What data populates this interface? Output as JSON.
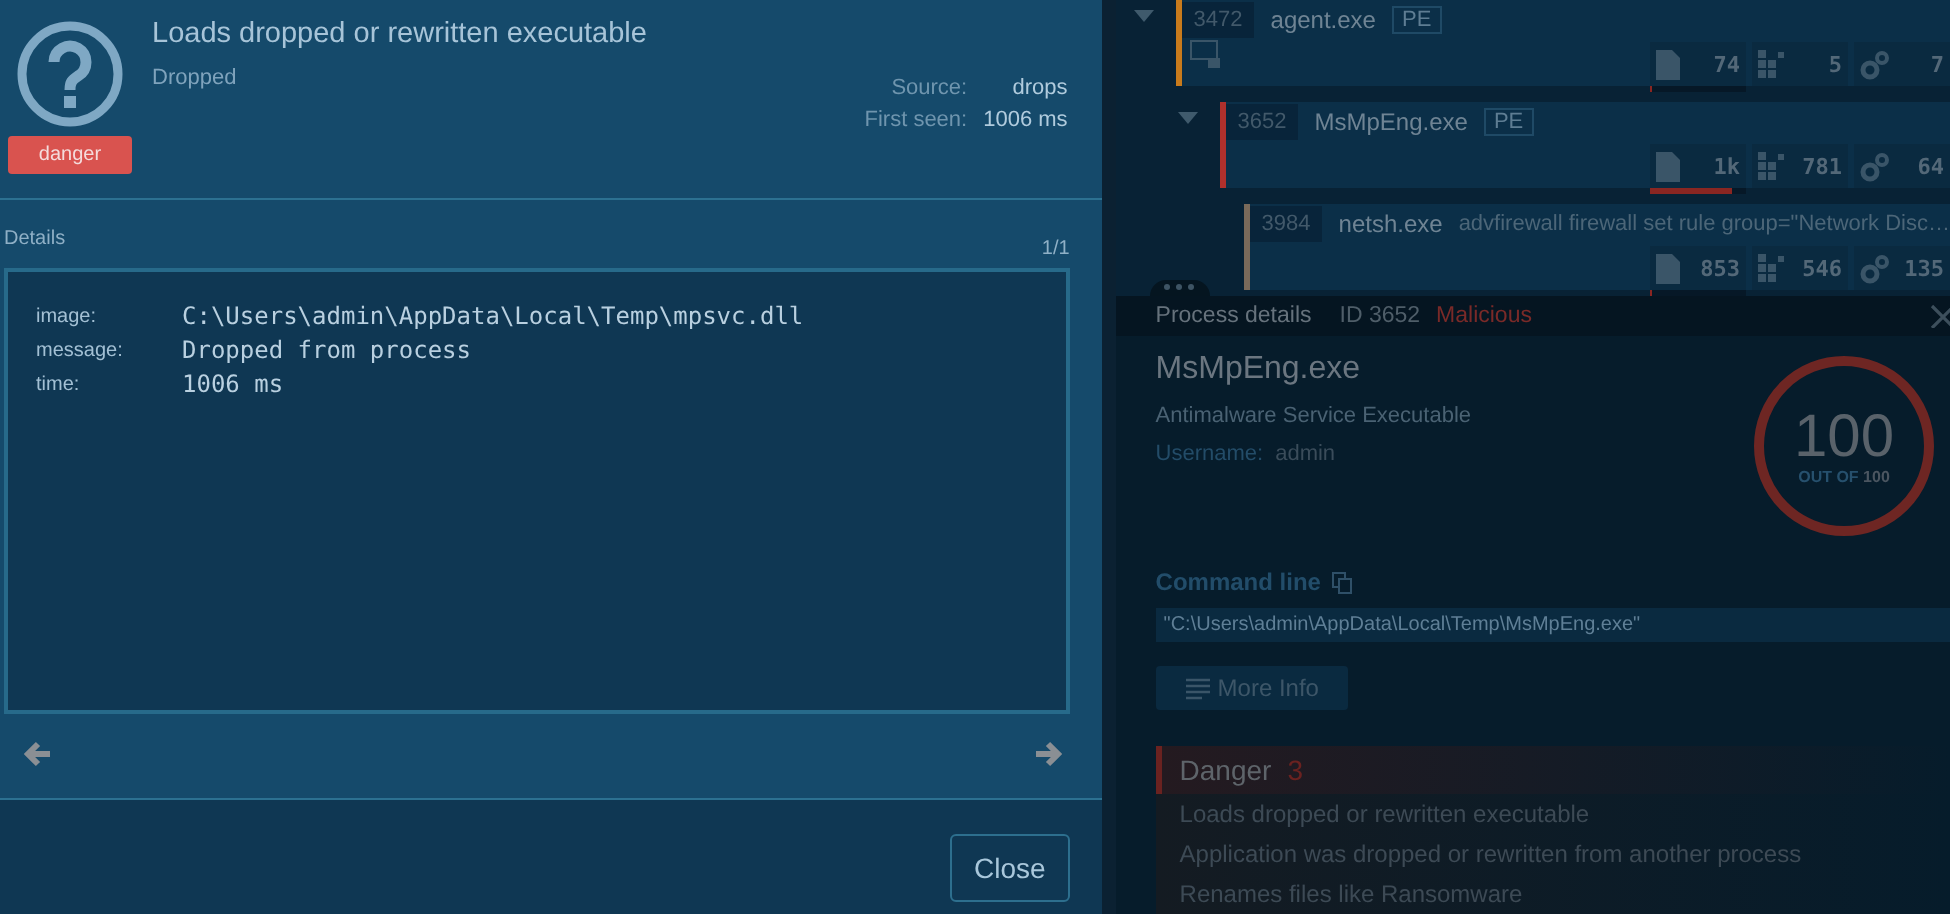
{
  "dialog": {
    "title": "Loads dropped or rewritten executable",
    "subtitle": "Dropped",
    "badge": "danger",
    "source_label": "Source:",
    "source": "drops",
    "first_seen_label": "First seen:",
    "first_seen": "1006 ms"
  },
  "details": {
    "heading": "Details",
    "pager": "1/1",
    "fields": [
      {
        "key": "image:",
        "value": "C:\\Users\\admin\\AppData\\Local\\Temp\\mpsvc.dll"
      },
      {
        "key": "message:",
        "value": "Dropped from process"
      },
      {
        "key": "time:",
        "value": "1006 ms"
      }
    ]
  },
  "close_button": "Close",
  "process_tree": [
    {
      "pid": "3472",
      "name": "agent.exe",
      "tag": "PE",
      "expanded": true,
      "color": "#c97b1c",
      "files": "74",
      "registry": "5",
      "modules": "7",
      "level": 0.02,
      "children": [
        {
          "pid": "3652",
          "name": "MsMpEng.exe",
          "tag": "PE",
          "expanded": true,
          "color": "#b0302c",
          "files": "1k",
          "registry": "781",
          "modules": "64",
          "level": 0.85,
          "children": [
            {
              "pid": "3984",
              "name": "netsh.exe",
              "args": "advfirewall firewall set rule group=\"Network Disc…",
              "color": "#7a6a5a",
              "files": "853",
              "registry": "546",
              "modules": "135",
              "level": 0.02
            }
          ]
        }
      ]
    }
  ],
  "process_details": {
    "title": "Process details",
    "id": "ID 3652",
    "verdict": "Malicious",
    "name": "MsMpEng.exe",
    "description": "Antimalware Service Executable",
    "username_label": "Username:",
    "username": "admin",
    "score": "100",
    "score_prefix": "OUT OF",
    "score_max": "100",
    "command_label": "Command line",
    "command": "\"C:\\Users\\admin\\AppData\\Local\\Temp\\MsMpEng.exe\"",
    "more_info": "More Info",
    "danger_label": "Danger",
    "danger_count": "3",
    "danger_items": [
      "Loads dropped or rewritten executable",
      "Application was dropped or rewritten from another process",
      "Renames files like Ransomware"
    ]
  }
}
